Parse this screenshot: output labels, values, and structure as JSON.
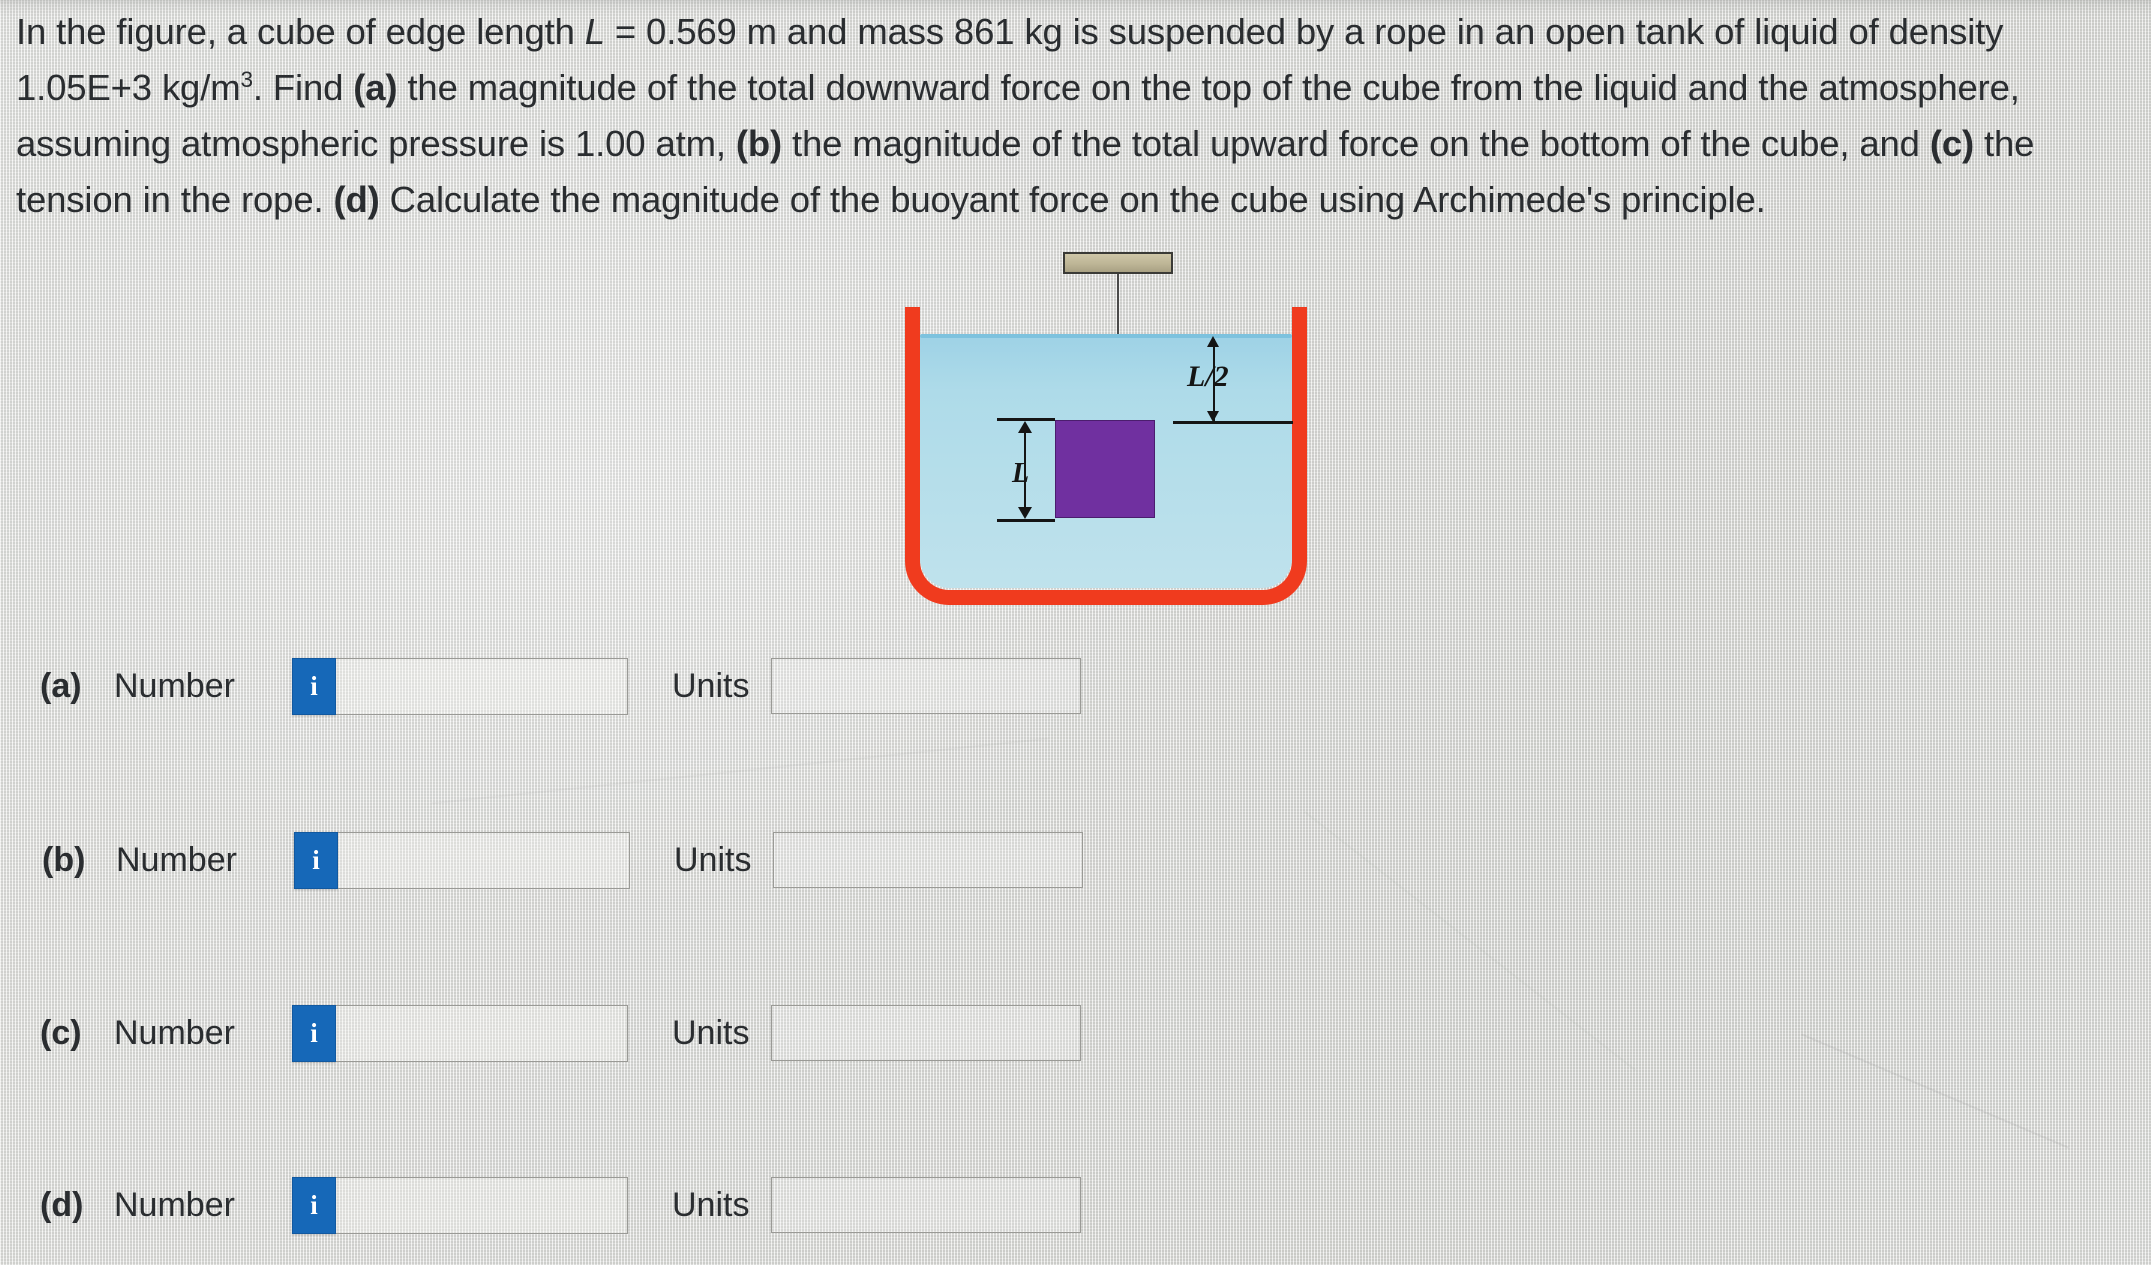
{
  "problem": {
    "line1_a": "In the figure, a cube of edge length ",
    "var_L": "L",
    "line1_b": " = 0.569 m and mass 861 kg is suspended by a rope in an open tank of liquid of density 1.05E+3",
    "line2_a": "kg/m",
    "line2_sup": "3",
    "line2_b": ". Find ",
    "part_a": "(a)",
    "line2_c": " the magnitude of the total downward force on the top of the cube from the liquid and the atmosphere, assuming",
    "line3_a": "atmospheric pressure is 1.00 atm, ",
    "part_b": "(b)",
    "line3_b": " the magnitude of the total upward force on the bottom of the cube, and ",
    "part_c": "(c)",
    "line3_c": " the tension in the",
    "line4_a": "rope. ",
    "part_d": "(d)",
    "line4_b": " Calculate the magnitude of the buoyant force on the cube using Archimede's principle."
  },
  "figure": {
    "label_L": "L",
    "label_L_half": "L/2",
    "colors": {
      "tank_wall": "#f03b1e",
      "liquid": "#aedbe9",
      "cube": "#7030a0",
      "support_bar": "#bdb596"
    }
  },
  "answers": {
    "number_label": "Number",
    "units_label": "Units",
    "info_icon_glyph": "i",
    "rows": [
      {
        "key": "(a)",
        "number_value": "",
        "units_value": ""
      },
      {
        "key": "(b)",
        "number_value": "",
        "units_value": ""
      },
      {
        "key": "(c)",
        "number_value": "",
        "units_value": ""
      },
      {
        "key": "(d)",
        "number_value": "",
        "units_value": ""
      }
    ]
  },
  "theme": {
    "accent_blue": "#1668b8",
    "page_background": "#e4e4e1",
    "text_color": "#2a2d30"
  }
}
